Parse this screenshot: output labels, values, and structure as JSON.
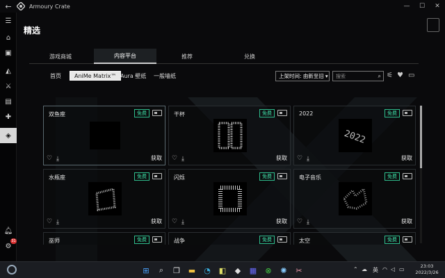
{
  "app": {
    "title": "Armoury Crate"
  },
  "page": {
    "title": "精选"
  },
  "tabs": [
    {
      "label": "游戏商城"
    },
    {
      "label": "内容平台"
    },
    {
      "label": "推荐"
    },
    {
      "label": "兑换"
    }
  ],
  "subnav": [
    {
      "label": "首页"
    },
    {
      "label": "AniMe Matrix™"
    },
    {
      "label": "Aura 壁纸"
    },
    {
      "label": "一般墙纸"
    }
  ],
  "sort": {
    "label": "上架时间: 由新至旧"
  },
  "search": {
    "placeholder": "搜索"
  },
  "cards": [
    {
      "name": "双鱼座",
      "badge": "免费",
      "action": "获取"
    },
    {
      "name": "干杯",
      "badge": "免费",
      "action": "获取"
    },
    {
      "name": "2022",
      "badge": "免费",
      "action": "获取"
    },
    {
      "name": "水瓶座",
      "badge": "免费",
      "action": "获取"
    },
    {
      "name": "闪烁",
      "badge": "免费",
      "action": "获取"
    },
    {
      "name": "电子音乐",
      "badge": "免费",
      "action": "获取"
    },
    {
      "name": "巫师",
      "badge": "免费",
      "action": "获取"
    },
    {
      "name": "战争",
      "badge": "免费",
      "action": "获取"
    },
    {
      "name": "太空",
      "badge": "免费",
      "action": "获取"
    }
  ],
  "notifications": {
    "count": "31"
  },
  "tray": {
    "ime": "英"
  },
  "clock": {
    "time": "23:03",
    "date": "2022/3/26"
  },
  "colors": {
    "accent": "#3fe0a8",
    "background": "#0a0a0c",
    "taskbar": "#1b1d22"
  }
}
